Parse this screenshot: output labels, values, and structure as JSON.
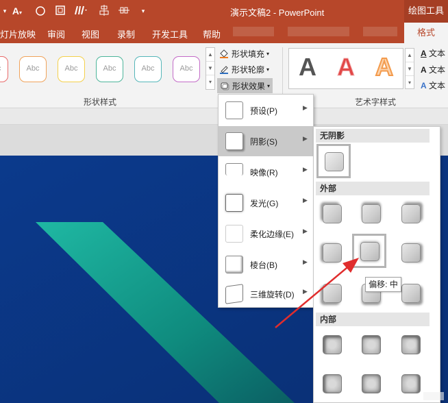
{
  "title_bar": {
    "document_title": "演示文稿2  -  PowerPoint",
    "context_tab_group": "绘图工具"
  },
  "quick_access": {
    "icons": [
      "text-color-icon",
      "circle-icon",
      "frame-icon",
      "brush-icon",
      "align-icon",
      "distribute-icon",
      "dropdown-icon"
    ]
  },
  "tabs": [
    {
      "label": "灯片放映"
    },
    {
      "label": "审阅"
    },
    {
      "label": "视图"
    },
    {
      "label": "录制"
    },
    {
      "label": "开发工具"
    },
    {
      "label": "帮助"
    },
    {
      "label": "格式"
    }
  ],
  "ribbon": {
    "shape_styles_gallery": {
      "sample_label": "Abc",
      "outline_colors": [
        "#e86a6a",
        "#f0a35a",
        "#f4d04a",
        "#4cb59a",
        "#55b6b9",
        "#c36bc7"
      ]
    },
    "fill_label": "形状填充",
    "outline_label": "形状轮廓",
    "effects_label": "形状效果",
    "shape_styles_group": "形状样式",
    "wordart_group": "艺术字样式",
    "wordart_sample": "A",
    "wordart_colors": [
      "#555555",
      "#e24848",
      "#f7a35c"
    ],
    "text_fill_label": "文本",
    "text_outline_label": "文本",
    "text_effects_label": "文本"
  },
  "effects_menu": {
    "items": [
      {
        "label": "预设(P)"
      },
      {
        "label": "阴影(S)"
      },
      {
        "label": "映像(R)"
      },
      {
        "label": "发光(G)"
      },
      {
        "label": "柔化边缘(E)"
      },
      {
        "label": "棱台(B)"
      },
      {
        "label": "三维旋转(D)"
      }
    ],
    "active_index": 1
  },
  "shadow_submenu": {
    "no_shadow_heading": "无阴影",
    "outer_heading": "外部",
    "inner_heading": "内部",
    "tooltip": "偏移: 中"
  },
  "colors": {
    "accent": "#b7472a",
    "slide_background": "#0d3b89",
    "slide_band": "#1aa89a",
    "arrow": "#e02d2d"
  }
}
